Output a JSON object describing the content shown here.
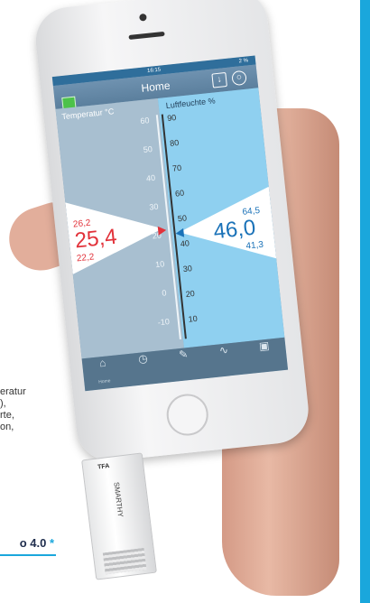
{
  "side_text": {
    "lines": [
      "eratur",
      "),",
      "rte,",
      "on,"
    ]
  },
  "promo": {
    "label": "o 4.0",
    "star": "*"
  },
  "phone": {
    "statusbar": {
      "time": "16:15",
      "battery": "2 %"
    },
    "navbar": {
      "title": "Home"
    },
    "temperature": {
      "header": "Temperatur °C",
      "ticks": [
        "60",
        "50",
        "40",
        "30",
        "20",
        "10",
        "0",
        "-10"
      ],
      "max": "26,2",
      "current": "25,4",
      "min": "22,2"
    },
    "humidity": {
      "header": "Luftfeuchte %",
      "ticks": [
        "90",
        "80",
        "70",
        "60",
        "50",
        "40",
        "30",
        "20",
        "10"
      ],
      "max": "64,5",
      "current": "46,0",
      "min": "41,3"
    },
    "tabs": [
      {
        "label": "Home",
        "icon": "home-icon"
      },
      {
        "label": "",
        "icon": "clock-icon"
      },
      {
        "label": "",
        "icon": "edit-icon"
      },
      {
        "label": "",
        "icon": "chart-icon"
      },
      {
        "label": "",
        "icon": "camera-icon"
      }
    ]
  },
  "sensor": {
    "logo": "TFA",
    "name": "SMARTHY"
  },
  "colors": {
    "accent": "#1aa7dc",
    "temp_value": "#e2323a",
    "humidity_value": "#1a72b8"
  }
}
